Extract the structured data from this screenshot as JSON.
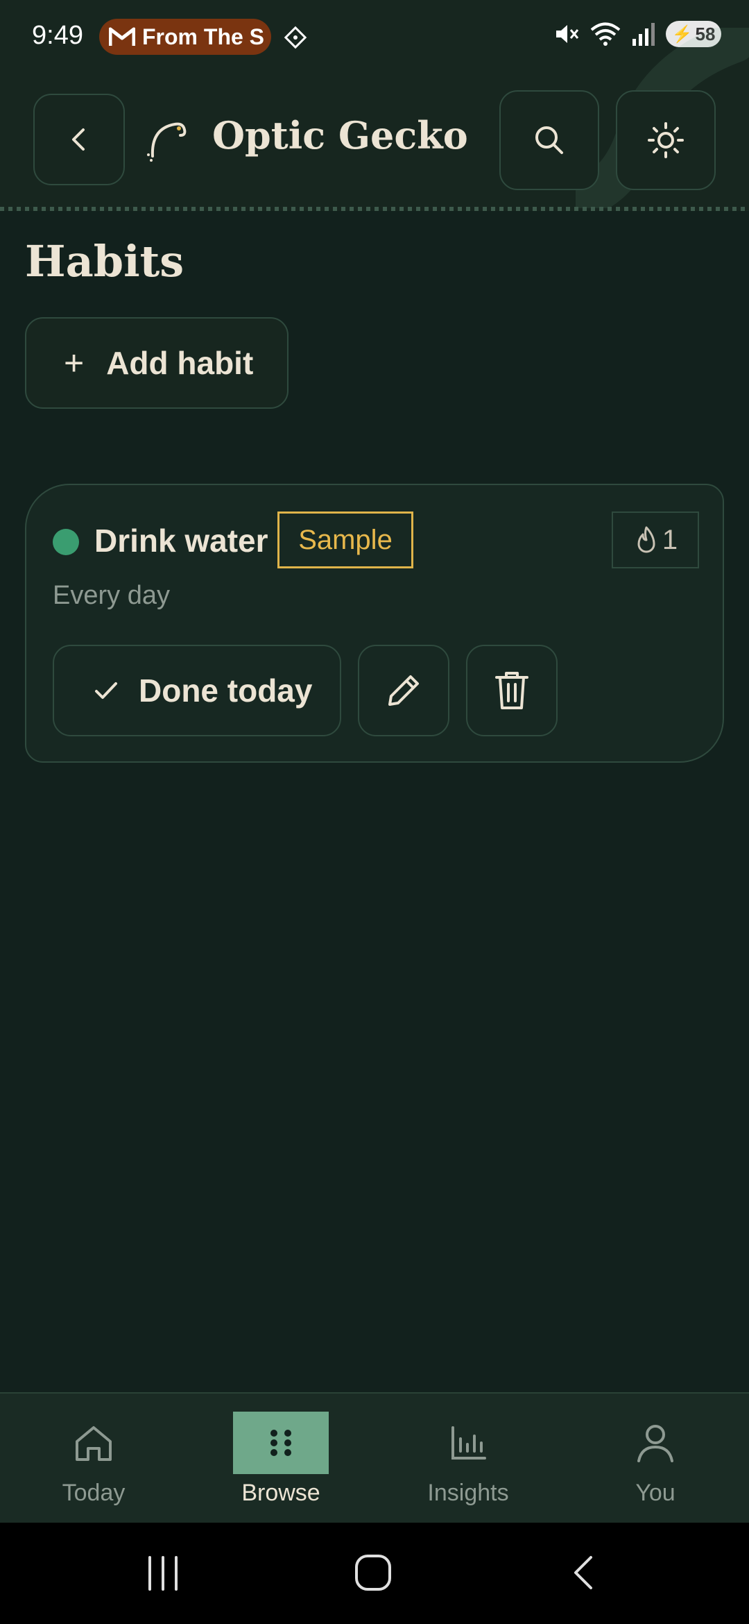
{
  "status_bar": {
    "time": "9:49",
    "notification_text": "From The S",
    "battery": "58"
  },
  "header": {
    "app_title": "Optic Gecko"
  },
  "main": {
    "page_title": "Habits",
    "add_habit_label": "Add habit"
  },
  "habit": {
    "name": "Drink water",
    "badge": "Sample",
    "streak": "1",
    "frequency": "Every day",
    "done_label": "Done today",
    "dot_color": "#3a9d70"
  },
  "bottom_nav": {
    "items": [
      {
        "label": "Today",
        "icon": "home-icon"
      },
      {
        "label": "Browse",
        "icon": "grid-dots-icon"
      },
      {
        "label": "Insights",
        "icon": "bar-chart-icon"
      },
      {
        "label": "You",
        "icon": "user-icon"
      }
    ],
    "active_index": 1
  },
  "colors": {
    "background": "#12211d",
    "accent": "#6fa88a",
    "badge": "#e0b44a"
  }
}
